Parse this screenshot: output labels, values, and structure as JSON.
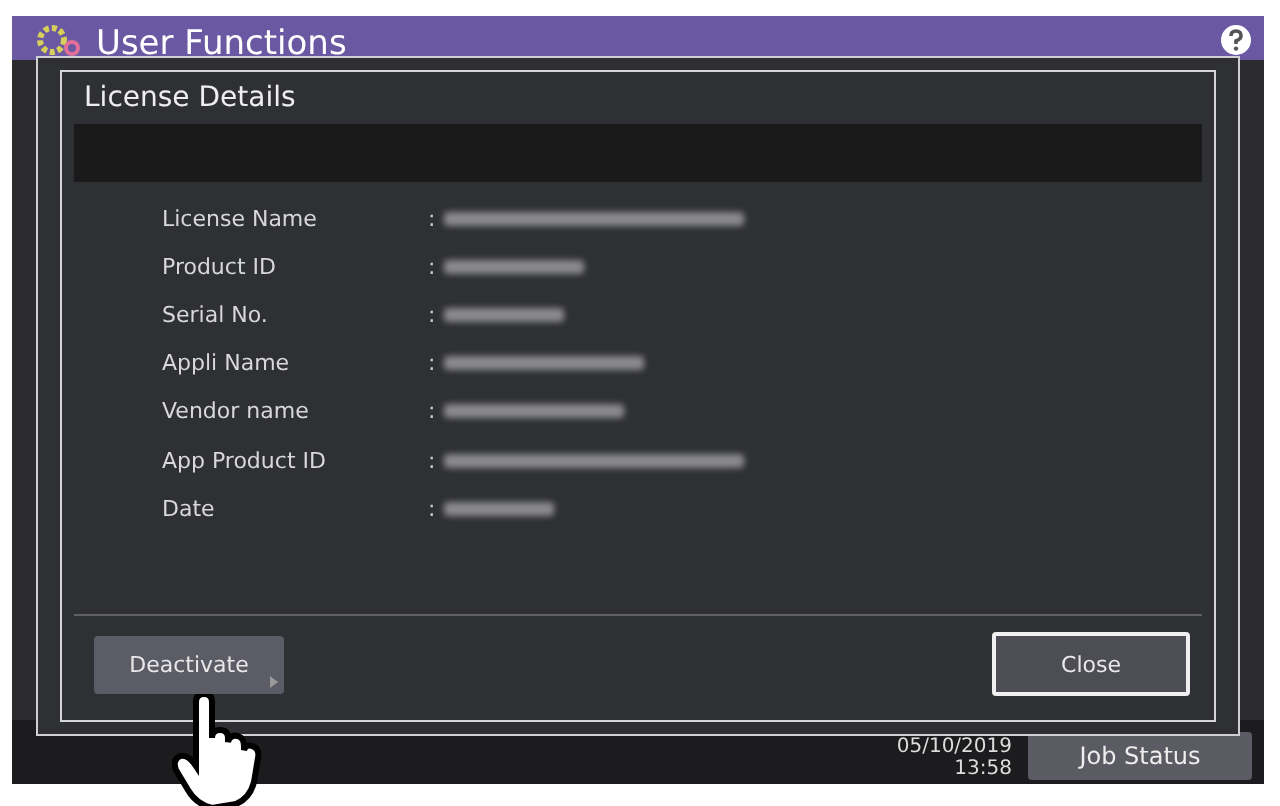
{
  "window": {
    "title": "User Functions"
  },
  "status_bar": {
    "date": "05/10/2019",
    "time": "13:58",
    "job_status_button": "Job Status"
  },
  "dialog": {
    "title": "License Details",
    "fields": [
      {
        "label": "License Name",
        "separator": ":"
      },
      {
        "label": "Product ID",
        "separator": ":"
      },
      {
        "label": "Serial No.",
        "separator": ":"
      },
      {
        "label": "Appli Name",
        "separator": ":"
      },
      {
        "label": "Vendor name",
        "separator": ":"
      },
      {
        "label": "App Product ID",
        "separator": ":"
      },
      {
        "label": "Date",
        "separator": ":"
      }
    ],
    "buttons": [
      {
        "label": "Deactivate",
        "kind": "menu"
      },
      {
        "label": "Close",
        "kind": "primary"
      }
    ]
  }
}
